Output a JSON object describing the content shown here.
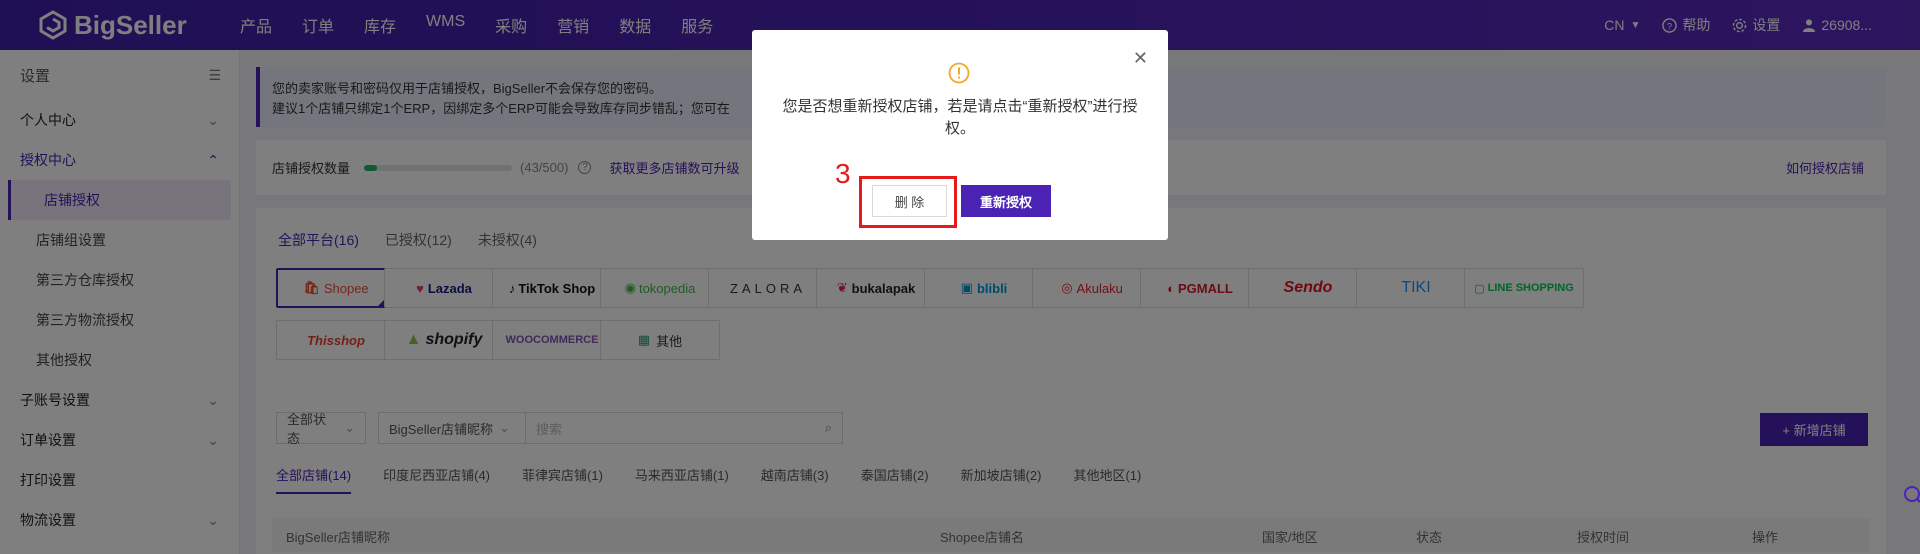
{
  "brand": {
    "name": "BigSeller",
    "accent": "#4b23b4"
  },
  "nav": [
    "产品",
    "订单",
    "库存",
    "WMS",
    "采购",
    "营销",
    "数据",
    "服务"
  ],
  "top_right": {
    "lang": "CN",
    "help": "帮助",
    "settings": "设置",
    "user": "26908..."
  },
  "sidebar": {
    "title": "设置",
    "groups": [
      {
        "label": "个人中心"
      },
      {
        "label": "授权中心"
      },
      {
        "label": "子账号设置"
      },
      {
        "label": "订单设置"
      },
      {
        "label": "打印设置"
      },
      {
        "label": "物流设置"
      }
    ],
    "auth_items": [
      "店铺授权",
      "店铺组设置",
      "第三方仓库授权",
      "第三方物流授权",
      "其他授权"
    ]
  },
  "notice": {
    "line1": "您的卖家账号和密码仅用于店铺授权，BigSeller不会保存您的密码。",
    "line2": "建议1个店铺只绑定1个ERP，因绑定多个ERP可能会导致库存同步错乱；您可在"
  },
  "quota": {
    "label": "店铺授权数量",
    "count": "(43/500)",
    "fraction": 0.086,
    "more_link": "获取更多店铺数可升级",
    "how_link": "如何授权店铺"
  },
  "platform_tabs": [
    "全部平台(16)",
    "已授权(12)",
    "未授权(4)"
  ],
  "platforms": [
    "Shopee",
    "Lazada",
    "TikTok Shop",
    "tokopedia",
    "ZALORA",
    "bukalapak",
    "blibli",
    "Akulaku",
    "PGMALL",
    "Sendo",
    "TIKI",
    "LINE SHOPPING",
    "Thisshop",
    "shopify",
    "WOOCOMMERCE",
    "其他"
  ],
  "filters": {
    "status": "全部状态",
    "nickname": "BigSeller店铺昵称",
    "search_placeholder": "搜索"
  },
  "add_button": "+ 新增店铺",
  "store_tabs": [
    "全部店铺(14)",
    "印度尼西亚店铺(4)",
    "菲律宾店铺(1)",
    "马来西亚店铺(1)",
    "越南店铺(3)",
    "泰国店铺(2)",
    "新加坡店铺(2)",
    "其他地区(1)"
  ],
  "table_headers": [
    "BigSeller店铺昵称",
    "Shopee店铺名",
    "国家/地区",
    "状态",
    "授权时间",
    "操作"
  ],
  "modal": {
    "message": "您是否想重新授权店铺，若是请点击“重新授权”进行授权。",
    "delete_label": "删 除",
    "reauth_label": "重新授权"
  },
  "annotation": {
    "number": "3"
  }
}
